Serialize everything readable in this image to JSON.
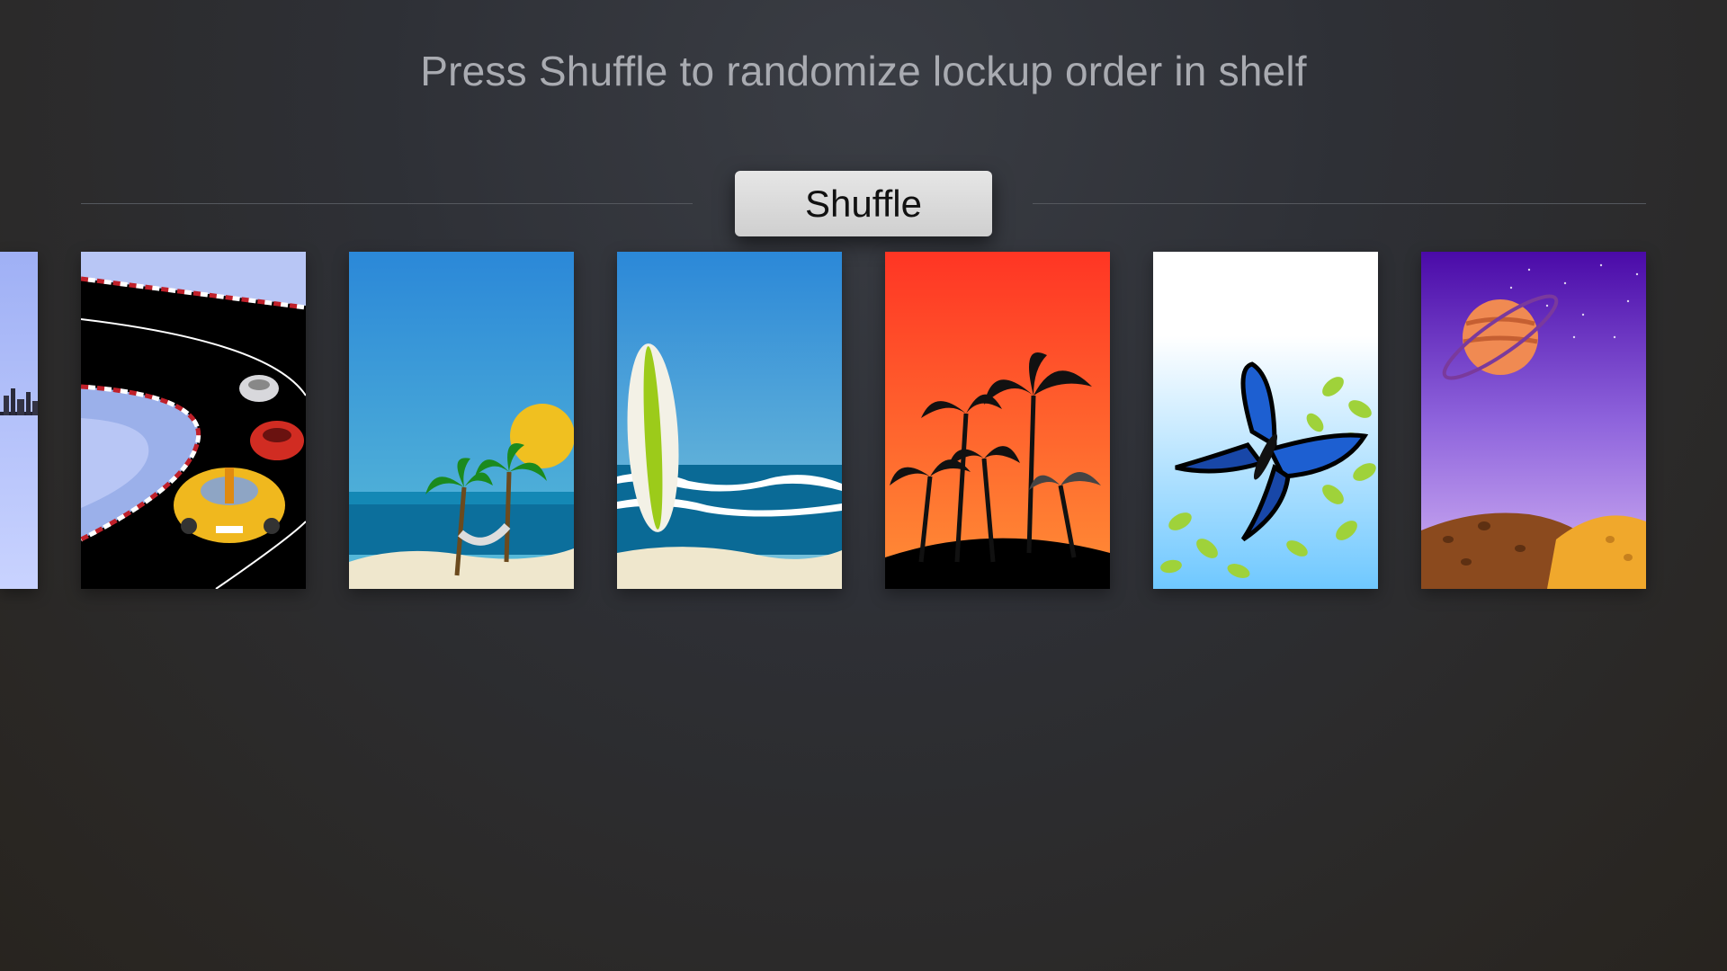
{
  "instruction": "Press Shuffle to randomize lockup order in shelf",
  "shuffle_button": {
    "label": "Shuffle"
  },
  "shelf": {
    "lockups": [
      {
        "name": "city-skyline",
        "partial": true
      },
      {
        "name": "race-track"
      },
      {
        "name": "beach-hammock"
      },
      {
        "name": "surfboard"
      },
      {
        "name": "sunset-palms"
      },
      {
        "name": "butterfly"
      },
      {
        "name": "ringed-planet"
      }
    ]
  }
}
